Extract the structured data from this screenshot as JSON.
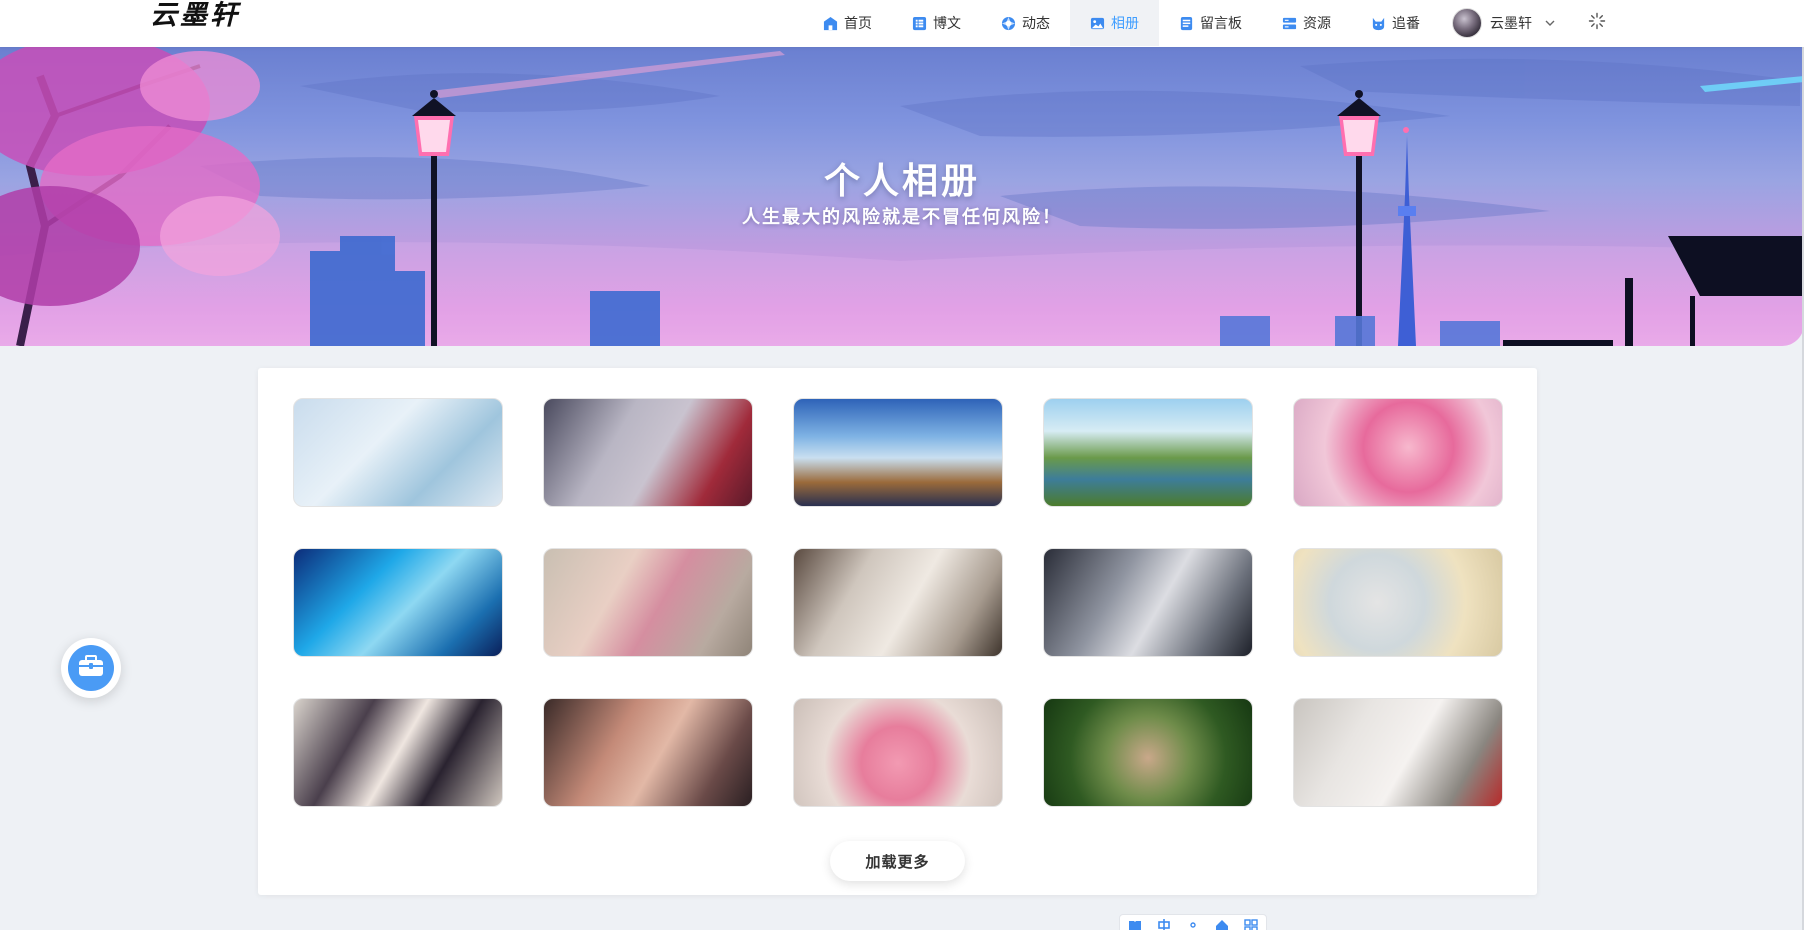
{
  "logo": "云墨轩",
  "nav": {
    "items": [
      {
        "label": "首页",
        "icon": "home-icon"
      },
      {
        "label": "博文",
        "icon": "article-list-icon"
      },
      {
        "label": "动态",
        "icon": "moments-icon"
      },
      {
        "label": "相册",
        "icon": "picture-icon",
        "active": true
      },
      {
        "label": "留言板",
        "icon": "message-board-icon"
      },
      {
        "label": "资源",
        "icon": "resource-icon"
      },
      {
        "label": "追番",
        "icon": "anime-cat-icon"
      }
    ],
    "user": {
      "name": "云墨轩"
    }
  },
  "banner": {
    "title": "个人相册",
    "subtitle": "人生最大的风险就是不冒任何风险！"
  },
  "gallery": {
    "load_more": "加载更多"
  },
  "colors": {
    "accent": "#409eff",
    "toolbox": "#4a9bf5"
  }
}
